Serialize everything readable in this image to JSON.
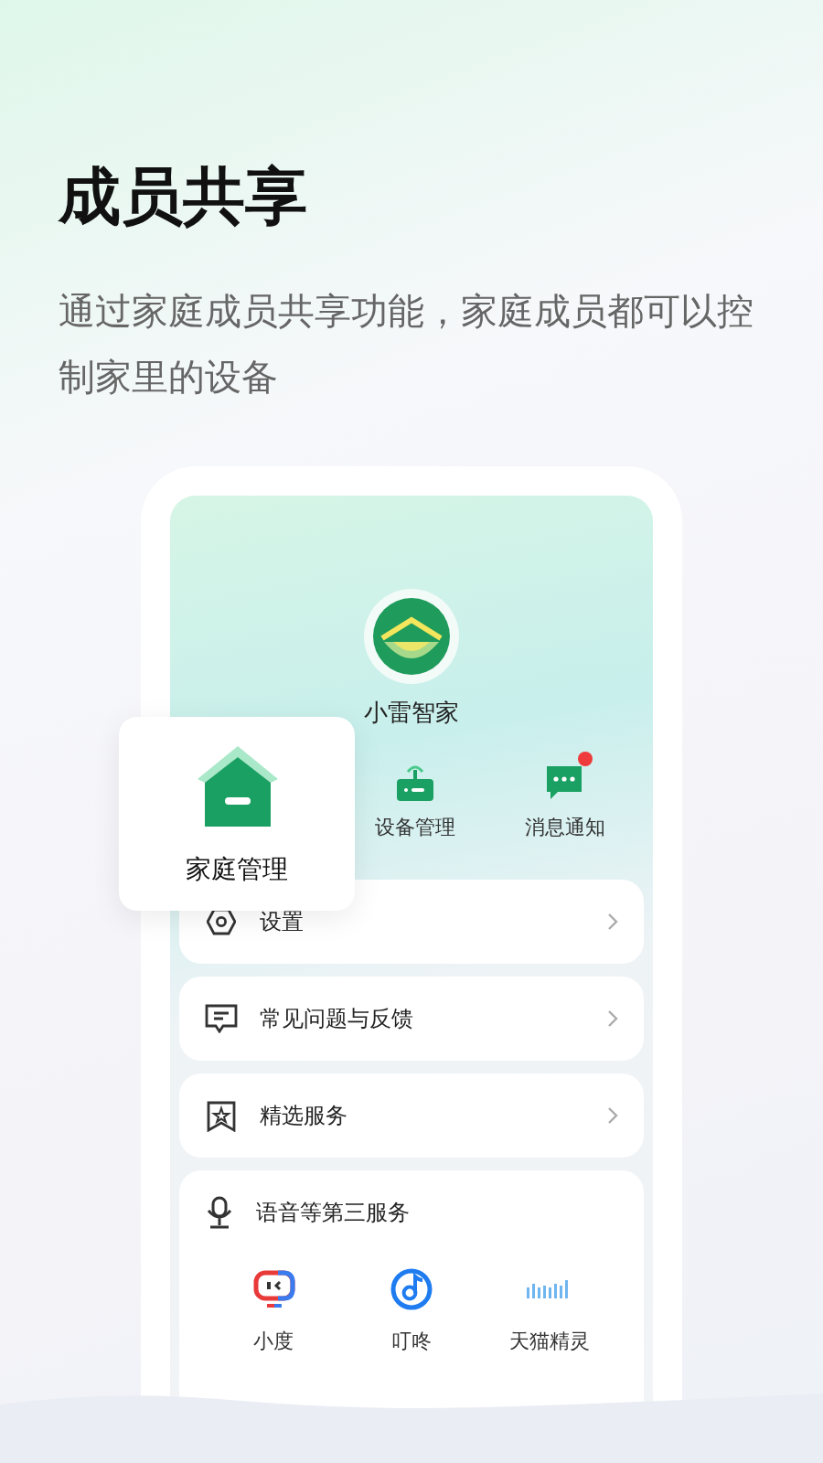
{
  "headline": "成员共享",
  "subtitle": "通过家庭成员共享功能，家庭成员都可以控制家里的设备",
  "app": {
    "name": "小雷智家"
  },
  "shortcuts": [
    {
      "label": "家庭管理",
      "kind": "home",
      "badge": false
    },
    {
      "label": "设备管理",
      "kind": "device",
      "badge": false
    },
    {
      "label": "消息通知",
      "kind": "message",
      "badge": true
    }
  ],
  "menu": [
    {
      "label": "设置",
      "kind": "settings"
    },
    {
      "label": "常见问题与反馈",
      "kind": "feedback"
    },
    {
      "label": "精选服务",
      "kind": "service"
    }
  ],
  "voice_services": {
    "title": "语音等第三服务",
    "items": [
      {
        "label": "小度",
        "kind": "xiaodu"
      },
      {
        "label": "叮咚",
        "kind": "dingdong"
      },
      {
        "label": "天猫精灵",
        "kind": "tmall"
      }
    ]
  }
}
